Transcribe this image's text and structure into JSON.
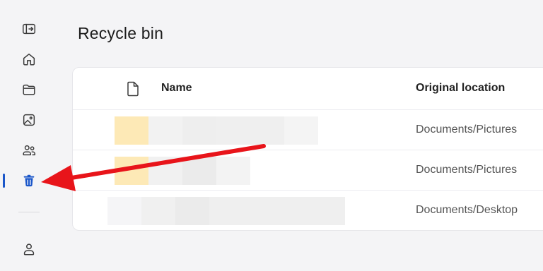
{
  "page": {
    "title": "Recycle bin"
  },
  "sidebar": {
    "items": [
      {
        "icon": "collapse-sidebar-icon"
      },
      {
        "icon": "home-icon"
      },
      {
        "icon": "folder-icon"
      },
      {
        "icon": "photos-icon"
      },
      {
        "icon": "people-icon"
      },
      {
        "icon": "trash-icon",
        "active": true
      },
      {
        "icon": "account-icon"
      }
    ],
    "active_color": "#1a56c9"
  },
  "table": {
    "columns": [
      "Name",
      "Original location"
    ],
    "rows": [
      {
        "name_redacted": true,
        "location": "Documents/Pictures"
      },
      {
        "name_redacted": true,
        "location": "Documents/Pictures"
      },
      {
        "name_redacted": true,
        "location": "Documents/Desktop"
      }
    ]
  },
  "annotation": {
    "arrow_color": "#e8141a",
    "points_to": "trash-icon"
  }
}
